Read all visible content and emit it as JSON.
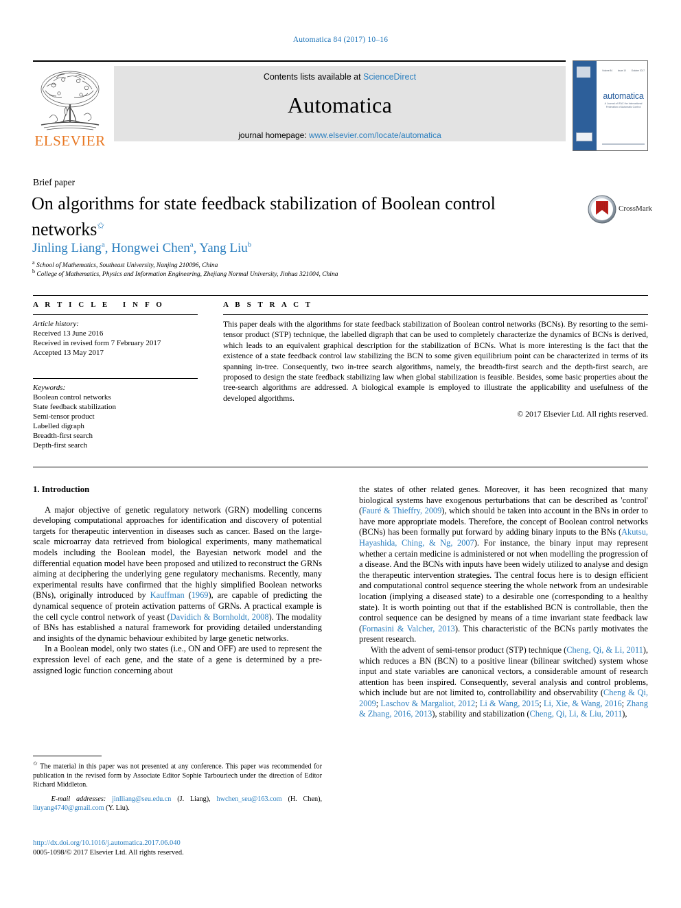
{
  "running_head": "Automatica 84 (2017) 10–16",
  "masthead": {
    "publisher_name": "ELSEVIER",
    "contents_prefix": "Contents lists available at ",
    "contents_link": "ScienceDirect",
    "journal_name": "Automatica",
    "homepage_prefix": "journal homepage: ",
    "homepage_link": "www.elsevier.com/locate/automatica",
    "cover": {
      "title": "automatica",
      "subtitle": "A Journal of IFAC the International Federation of Automatic Control",
      "top_left": "Volume 84",
      "top_mid": "Issue 10",
      "top_right": "October 2017"
    }
  },
  "article": {
    "type_label": "Brief paper",
    "title": "On algorithms for state feedback stabilization of Boolean control networks",
    "title_marker": "✩",
    "authors": [
      {
        "name": "Jinling Liang",
        "sup": "a"
      },
      {
        "name": "Hongwei Chen",
        "sup": "a"
      },
      {
        "name": "Yang Liu",
        "sup": "b"
      }
    ],
    "affiliations": [
      {
        "sup": "a",
        "text": "School of Mathematics, Southeast University, Nanjing 210096, China"
      },
      {
        "sup": "b",
        "text": "College of Mathematics, Physics and Information Engineering, Zhejiang Normal University, Jinhua 321004, China"
      }
    ],
    "crossmark_label": "CrossMark"
  },
  "article_info": {
    "heading": "ARTICLE INFO",
    "history_label": "Article history:",
    "history": [
      "Received 13 June 2016",
      "Received in revised form 7 February 2017",
      "Accepted 13 May 2017"
    ],
    "keywords_label": "Keywords:",
    "keywords": [
      "Boolean control networks",
      "State feedback stabilization",
      "Semi-tensor product",
      "Labelled digraph",
      "Breadth-first search",
      "Depth-first search"
    ]
  },
  "abstract": {
    "heading": "ABSTRACT",
    "text": "This paper deals with the algorithms for state feedback stabilization of Boolean control networks (BCNs). By resorting to the semi-tensor product (STP) technique, the labelled digraph that can be used to completely characterize the dynamics of BCNs is derived, which leads to an equivalent graphical description for the stabilization of BCNs. What is more interesting is the fact that the existence of a state feedback control law stabilizing the BCN to some given equilibrium point can be characterized in terms of its spanning in-tree. Consequently, two in-tree search algorithms, namely, the breadth-first search and the depth-first search, are proposed to design the state feedback stabilizing law when global stabilization is feasible. Besides, some basic properties about the tree-search algorithms are addressed. A biological example is employed to illustrate the applicability and usefulness of the developed algorithms.",
    "copyright": "© 2017 Elsevier Ltd. All rights reserved."
  },
  "body": {
    "section_number_title": "1. Introduction",
    "left_paragraphs": [
      "A major objective of genetic regulatory network (GRN) modelling concerns developing computational approaches for identification and discovery of potential targets for therapeutic intervention  in diseases such as cancer. Based on the large-scale microarray data retrieved from biological experiments, many mathematical models including the Boolean model, the Bayesian network model and the differential equation model have been proposed and utilized to reconstruct the GRNs aiming at deciphering the underlying gene regulatory mechanisms. Recently, many experimental results have confirmed that the highly simplified Boolean networks (BNs), originally introduced by [[Kauffman]] ([[1969]]), are capable of predicting the dynamical sequence of protein activation patterns of GRNs. A practical example is the cell cycle control network of yeast ([[Davidich & Bornholdt, 2008]]). The modality of BNs has established a natural framework for providing detailed understanding and insights of the dynamic behaviour exhibited by large genetic networks.",
      "In a Boolean model, only two states (i.e., ON and OFF) are used to represent the expression level of each gene, and the state of a gene is determined by a pre-assigned logic function concerning about"
    ],
    "right_paragraphs": [
      "the states of other related genes. Moreover, it has been recognized that many biological systems have exogenous perturbations that can be described as 'control' ([[Fauré & Thieffry, 2009]]), which should be taken into account in the BNs in order to have more appropriate models. Therefore, the concept of Boolean control networks (BCNs) has been formally put forward by adding binary inputs to the BNs  ([[Akutsu, Hayashida, Ching, & Ng, 2007]]). For instance, the binary input may represent whether a certain medicine is administered or not when modelling the progression of a disease. And the BCNs with inputs have been widely utilized to analyse and design the therapeutic intervention strategies. The central focus here is to design efficient and computational control sequence steering the whole network from an undesirable location (implying a diseased state) to a desirable one (corresponding to a healthy state). It is worth pointing out that if the established BCN is controllable, then the control sequence can be designed by means of a time invariant state feedback law ([[Fornasini & Valcher, 2013]]). This characteristic of the BCNs partly motivates the present research.",
      "With the advent of semi-tensor product (STP) technique ([[Cheng, Qi, & Li, 2011]]), which reduces a BN (BCN) to a positive linear (bilinear switched) system whose input and state variables are canonical vectors, a considerable amount of research attention has been inspired. Consequently, several analysis and control problems, which include but are not limited to, controllability and observability ([[Cheng & Qi, 2009]]; [[Laschov & Margaliot, 2012]]; [[Li & Wang, 2015]]; [[Li, Xie, & Wang, 2016]]; [[Zhang & Zhang, 2016, 2013]]), stability and stabilization  ([[Cheng, Qi, Li, & Liu, 2011]]),"
    ]
  },
  "footer": {
    "footnote_marker": "✩",
    "footnote": "The material in this paper was not presented at any conference. This paper was recommended for publication in the revised form by Associate Editor Sophie Tarbouriech under the direction of Editor Richard Middleton.",
    "emails_label": "E-mail addresses:",
    "emails": [
      {
        "address": "jinlliang@seu.edu.cn",
        "owner": "(J. Liang)"
      },
      {
        "address": "hwchen_seu@163.com",
        "owner": "(H. Chen)"
      },
      {
        "address": "liuyang4740@gmail.com",
        "owner": "(Y. Liu)"
      }
    ],
    "doi": "http://dx.doi.org/10.1016/j.automatica.2017.06.040",
    "issn_line": "0005-1098/© 2017 Elsevier Ltd. All rights reserved."
  },
  "colors": {
    "link_blue": "#2b7fbf",
    "elsevier_orange": "#e87722",
    "cover_blue": "#2d5f9a"
  }
}
